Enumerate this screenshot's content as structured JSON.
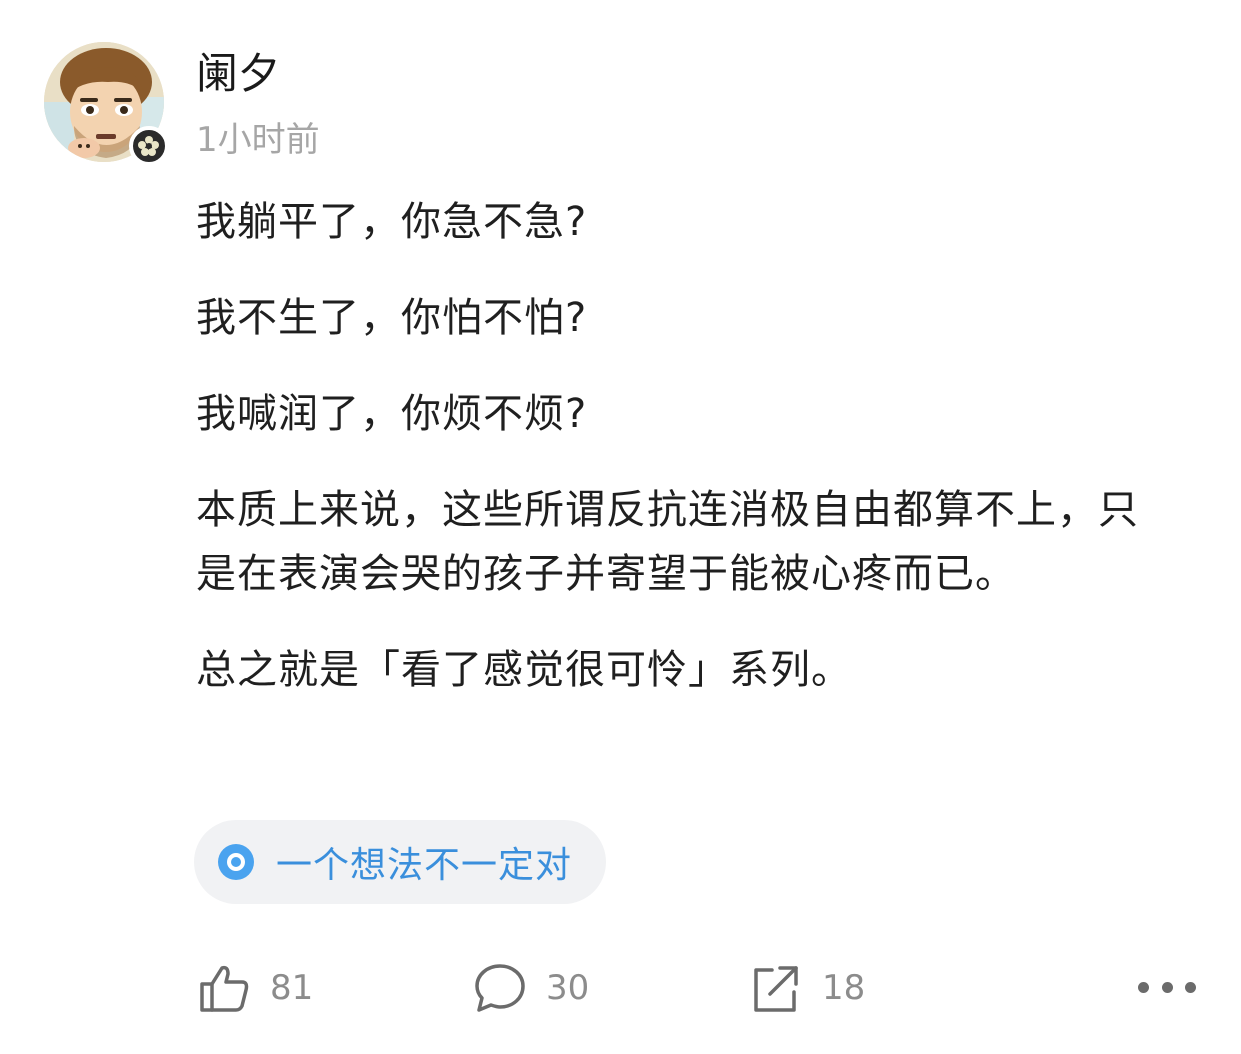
{
  "author": {
    "name": "阑夕",
    "timestamp": "1小时前"
  },
  "content": {
    "paragraphs": [
      "我躺平了，你急不急?",
      "我不生了，你怕不怕?",
      "我喊润了，你烦不烦?",
      "本质上来说，这些所谓反抗连消极自由都算不上，只是在表演会哭的孩子并寄望于能被心疼而已。",
      "总之就是「看了感觉很可怜」系列。"
    ]
  },
  "tag": {
    "label": "一个想法不一定对",
    "color": "#4aa3ef"
  },
  "actions": {
    "like": {
      "icon": "thumbs-up-icon",
      "count": "81"
    },
    "comment": {
      "icon": "comment-bubble-icon",
      "count": "30"
    },
    "share": {
      "icon": "share-icon",
      "count": "18"
    },
    "more": {
      "icon": "more-dots-icon"
    }
  },
  "colors": {
    "text": "#1f1f1f",
    "muted": "#a6a6a6",
    "count": "#8c8c8c",
    "accent": "#3a8fdc",
    "pill_bg": "#f1f2f4"
  }
}
